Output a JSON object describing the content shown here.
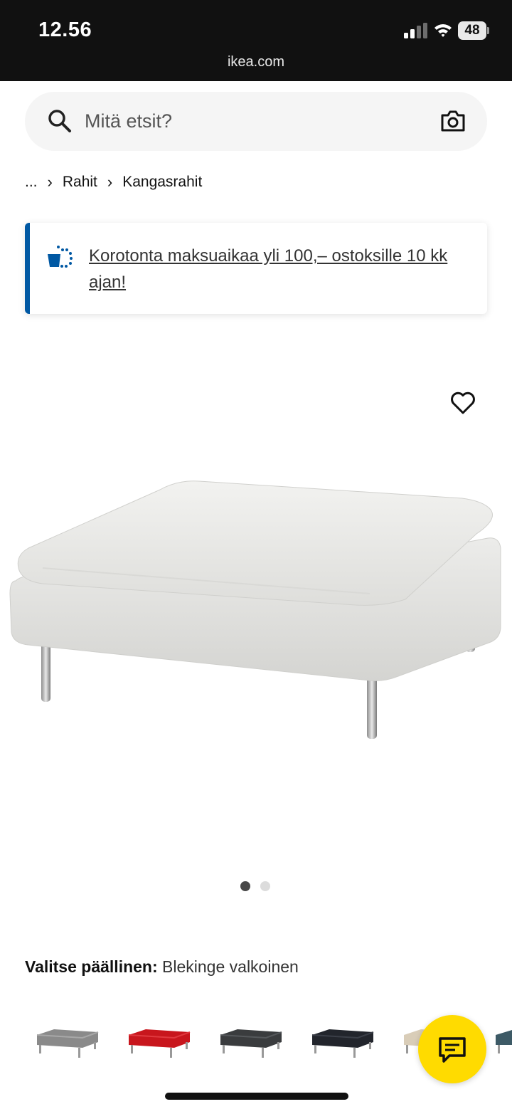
{
  "status_bar": {
    "time": "12.56",
    "url": "ikea.com",
    "battery": "48"
  },
  "search": {
    "placeholder": "Mitä etsit?"
  },
  "breadcrumb": {
    "items": [
      "...",
      "Rahit",
      "Kangasrahit"
    ]
  },
  "promo": {
    "text": "Korotonta maksuaikaa yli 100,– ostoksille 10 kk ajan!",
    "accent_color": "#0058a3"
  },
  "product": {
    "image_alt": "SÖDERHAMN rahi",
    "carousel": {
      "current": 1,
      "total": 2
    }
  },
  "cover": {
    "label": "Valitse päällinen:",
    "selected": "Blekinge valkoinen",
    "swatches": [
      {
        "color": "#8a8a8a"
      },
      {
        "color": "#c8161d"
      },
      {
        "color": "#3a3c3e"
      },
      {
        "color": "#22252c"
      },
      {
        "color": "#d9cdb8"
      },
      {
        "color": "#3d5a66"
      }
    ]
  },
  "chat": {
    "color": "#ffdb00"
  }
}
